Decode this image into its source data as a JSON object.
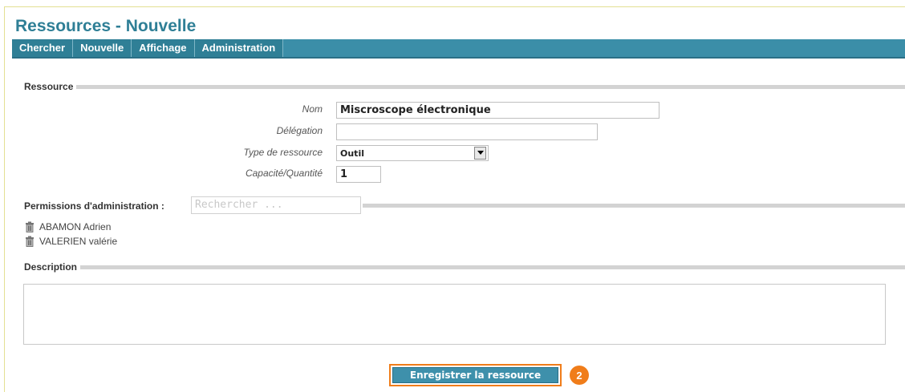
{
  "page": {
    "title": "Ressources - Nouvelle"
  },
  "nav": {
    "items": [
      "Chercher",
      "Nouvelle",
      "Affichage",
      "Administration"
    ]
  },
  "sections": {
    "resource": "Ressource",
    "permissions": "Permissions d'administration :",
    "description": "Description"
  },
  "form": {
    "nom": {
      "label": "Nom",
      "value": "Miscroscope électronique"
    },
    "delegation": {
      "label": "Délégation",
      "value": ""
    },
    "type": {
      "label": "Type de ressource",
      "value": "Outil"
    },
    "capacite": {
      "label": "Capacité/Quantité",
      "value": "1"
    }
  },
  "permissions": {
    "search_placeholder": "Rechercher ...",
    "users": [
      "ABAMON Adrien",
      "VALERIEN valérie"
    ]
  },
  "description": {
    "value": ""
  },
  "actions": {
    "save_label": "Enregistrer la ressource",
    "step_badge": "2"
  },
  "colors": {
    "accent": "#2f7f96",
    "highlight": "#f07d1a",
    "section_line": "#d3d3d3"
  }
}
